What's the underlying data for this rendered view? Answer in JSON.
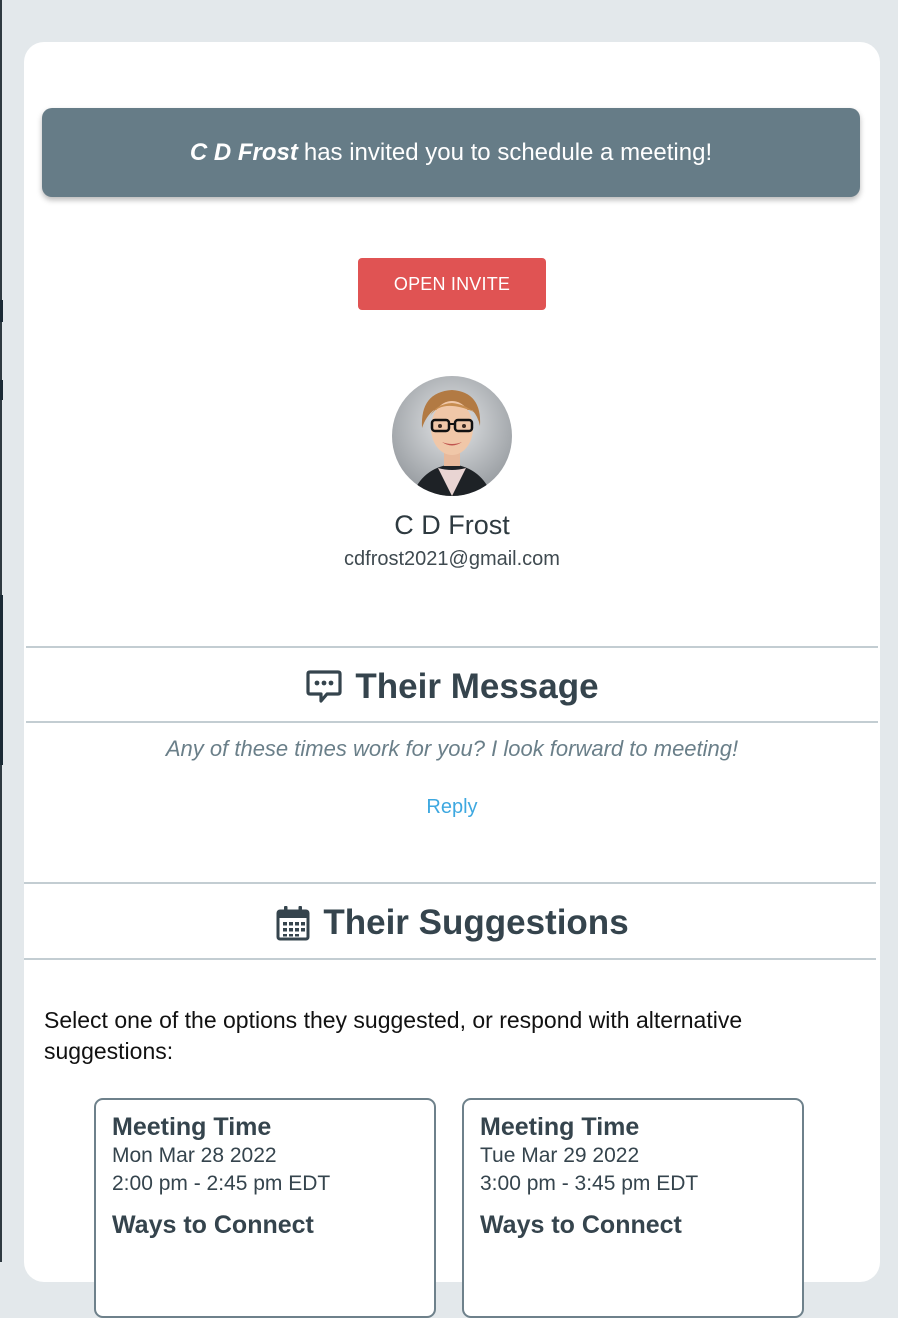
{
  "banner": {
    "inviter": "C D Frost",
    "text": "has invited you to schedule a meeting!"
  },
  "open_invite_label": "OPEN INVITE",
  "profile": {
    "name": "C D Frost",
    "email": "cdfrost2021@gmail.com"
  },
  "message_section": {
    "title": "Their Message",
    "icon": "chat-bubble-icon",
    "message": "Any of these times work for you? I look forward to meeting!",
    "reply_label": "Reply"
  },
  "suggestions_section": {
    "title": "Their Suggestions",
    "icon": "calendar-icon",
    "instructions": "Select one of the options they suggested, or respond with alternative suggestions:"
  },
  "options": [
    {
      "time_label": "Meeting Time",
      "date": "Mon Mar 28 2022",
      "time": "2:00 pm - 2:45 pm EDT",
      "connect_label": "Ways to Connect"
    },
    {
      "time_label": "Meeting Time",
      "date": "Tue Mar 29 2022",
      "time": "3:00 pm - 3:45 pm EDT",
      "connect_label": "Ways to Connect"
    }
  ],
  "colors": {
    "banner": "#667c87",
    "button": "#e05353",
    "link": "#3ea8e0",
    "page_background": "#e3e8eb"
  }
}
